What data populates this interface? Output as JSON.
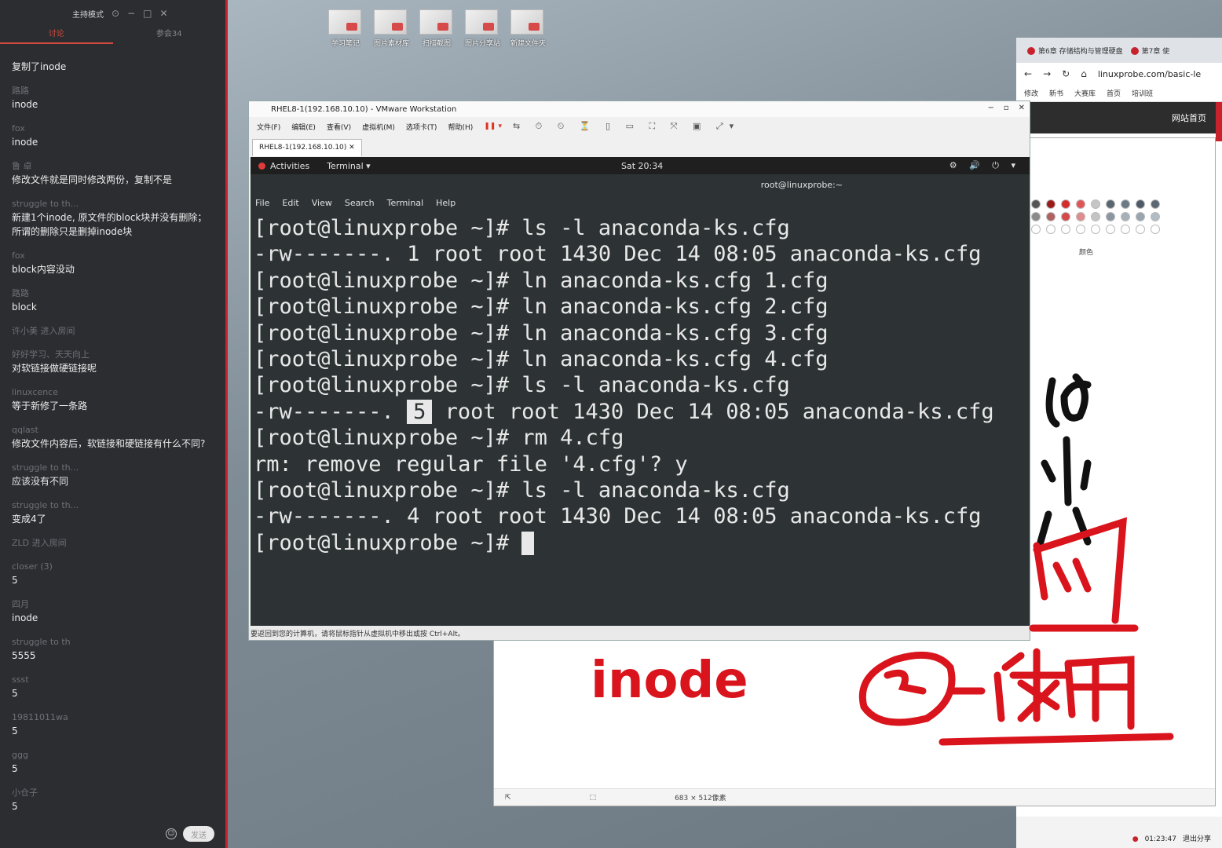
{
  "chat": {
    "header_title": "主持模式",
    "tabs": [
      "讨论",
      "参会34"
    ],
    "messages": [
      {
        "name": "",
        "text": "复制了inode"
      },
      {
        "name": "路路",
        "text": "inode"
      },
      {
        "name": "fox",
        "text": "inode"
      },
      {
        "name": "鲁    卓",
        "text": "修改文件就是同时修改两份，复制不是"
      },
      {
        "name": "struggle to th...",
        "text": "新建1个inode, 原文件的block块并没有删除；所谓的删除只是删掉inode块"
      },
      {
        "name": "fox",
        "text": "block内容没动"
      },
      {
        "name": "路路",
        "text": "block"
      },
      {
        "name": "许小美 进入房间",
        "text": ""
      },
      {
        "name": "好好学习、天天向上",
        "text": "对软链接做硬链接呢"
      },
      {
        "name": "linuxcence",
        "text": "等于新修了一条路"
      },
      {
        "name": "qqlast",
        "text": "修改文件内容后，软链接和硬链接有什么不同?"
      },
      {
        "name": "struggle to th...",
        "text": "应该没有不同"
      },
      {
        "name": "struggle to th...",
        "text": "变成4了"
      },
      {
        "name": "ZLD 进入房间",
        "text": ""
      },
      {
        "name": "closer  (3)",
        "text": "5"
      },
      {
        "name": "四月",
        "text": "inode"
      },
      {
        "name": "struggle to th",
        "text": "5555"
      },
      {
        "name": "ssst",
        "text": "5"
      },
      {
        "name": "19811011wa",
        "text": "5"
      },
      {
        "name": "ggg",
        "text": "5"
      },
      {
        "name": "小仓子",
        "text": "5"
      }
    ],
    "send_label": "发送"
  },
  "desktop_icons": [
    "学习笔记",
    "图片素材库",
    "扫描截图",
    "图片分享站",
    "新建文件夹"
  ],
  "browser": {
    "tabs": [
      "第6章 存储结构与管理硬盘",
      "第7章 使"
    ],
    "url": "linuxprobe.com/basic-le",
    "bookmarks": [
      "修改",
      "新书",
      "大赛库",
      "首页",
      "培训班"
    ],
    "site_nav": "网站首页",
    "clock": "01:23:47",
    "share_label": "退出分享"
  },
  "paint": {
    "status_size": "683 × 512像素",
    "palette_label": "颜色",
    "palette_colors": [
      "#555555",
      "#9b1b1b",
      "#d42b2b",
      "#e05656",
      "#c6c6c6",
      "#5a6670",
      "#6c7a86",
      "#4e5a66",
      "#5b6772",
      "#8a8a8a",
      "#b06060",
      "#d44a4a",
      "#e08c8c",
      "#c4c4c4",
      "#8a96a0",
      "#a6b0b8",
      "#98a4ae",
      "#b2bcc4",
      "#ffffff",
      "#ffffff",
      "#ffffff",
      "#ffffff",
      "#ffffff",
      "#ffffff",
      "#ffffff",
      "#ffffff",
      "#ffffff"
    ]
  },
  "vmware": {
    "title": "RHEL8-1(192.168.10.10) - VMware Workstation",
    "menu": [
      "文件(F)",
      "编辑(E)",
      "查看(V)",
      "虚拟机(M)",
      "选项卡(T)",
      "帮助(H)"
    ],
    "tab_label": "RHEL8-1(192.168.10.10)",
    "statusbar": "要返回到您的计算机，请将鼠标指针从虚拟机中移出或按 Ctrl+Alt。"
  },
  "gnome": {
    "activities": "Activities",
    "app": "Terminal ▾",
    "clock": "Sat 20:34",
    "sys_icons": "⚙ 🔊 ⏻ ▾"
  },
  "terminal": {
    "window_title": "root@linuxprobe:~",
    "menu": [
      "File",
      "Edit",
      "View",
      "Search",
      "Terminal",
      "Help"
    ],
    "lines": [
      "[root@linuxprobe ~]# ls -l anaconda-ks.cfg",
      "-rw-------. 1 root root 1430 Dec 14 08:05 anaconda-ks.cfg",
      "[root@linuxprobe ~]# ln anaconda-ks.cfg 1.cfg",
      "[root@linuxprobe ~]# ln anaconda-ks.cfg 2.cfg",
      "[root@linuxprobe ~]# ln anaconda-ks.cfg 3.cfg",
      "[root@linuxprobe ~]# ln anaconda-ks.cfg 4.cfg",
      "[root@linuxprobe ~]# ls -l anaconda-ks.cfg"
    ],
    "hl_prefix": "-rw-------.",
    "hl_value": "5",
    "hl_suffix": "root root 1430 Dec 14 08:05 anaconda-ks.cfg",
    "lines_after": [
      "[root@linuxprobe ~]# rm 4.cfg",
      "rm: remove regular file '4.cfg'? y",
      "[root@linuxprobe ~]# ls -l anaconda-ks.cfg",
      "-rw-------. 4 root root 1430 Dec 14 08:05 anaconda-ks.cfg"
    ],
    "prompt": "[root@linuxprobe ~]# "
  },
  "annotations": {
    "word1": "inode",
    "word2": "②使用"
  }
}
